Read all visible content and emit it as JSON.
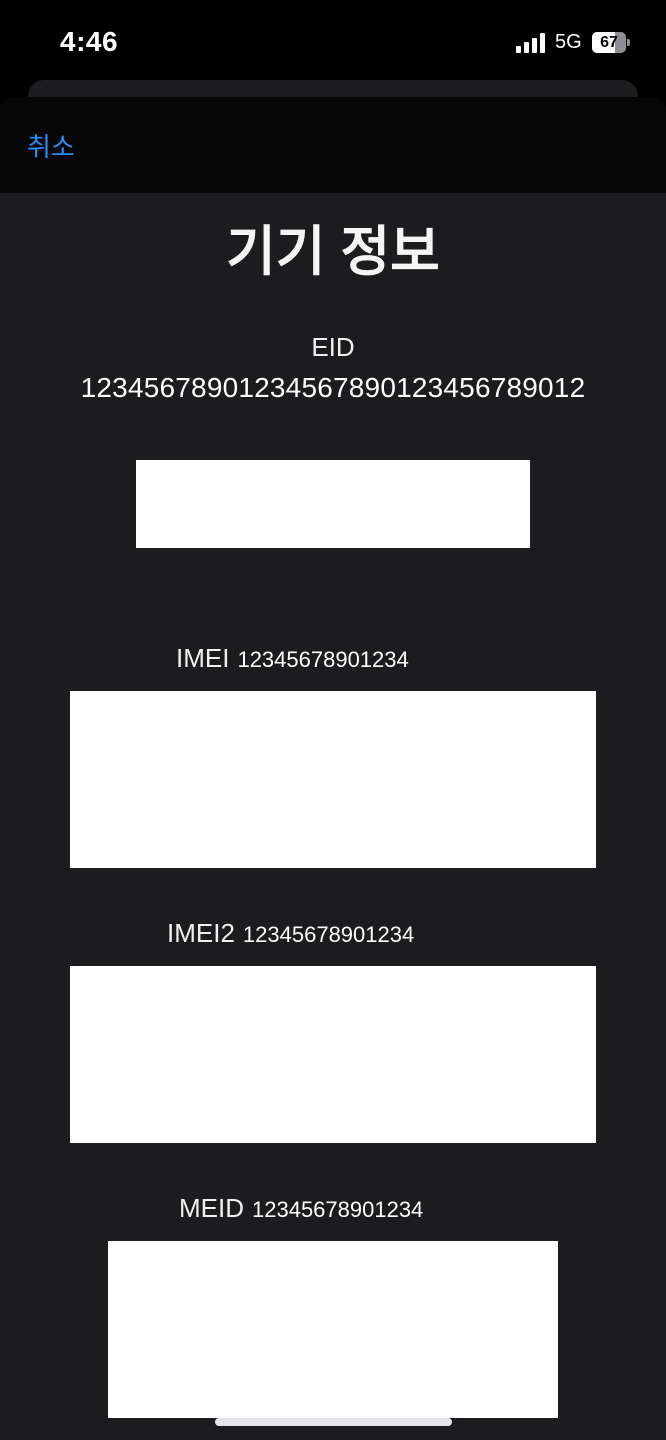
{
  "status_bar": {
    "time": "4:46",
    "network": "5G",
    "battery_percent": "67",
    "battery_level": 0.67
  },
  "nav": {
    "cancel_label": "취소"
  },
  "title": "기기 정보",
  "eid": {
    "label": "EID",
    "value": "12345678901234567890123456789012"
  },
  "identifiers": [
    {
      "label": "IMEI",
      "value": "12345678901234"
    },
    {
      "label": "IMEI2",
      "value": "12345678901234"
    },
    {
      "label": "MEID",
      "value": "12345678901234"
    }
  ],
  "colors": {
    "accent": "#2a8cf5",
    "background": "#1c1c1e",
    "nav_background": "#060606"
  }
}
